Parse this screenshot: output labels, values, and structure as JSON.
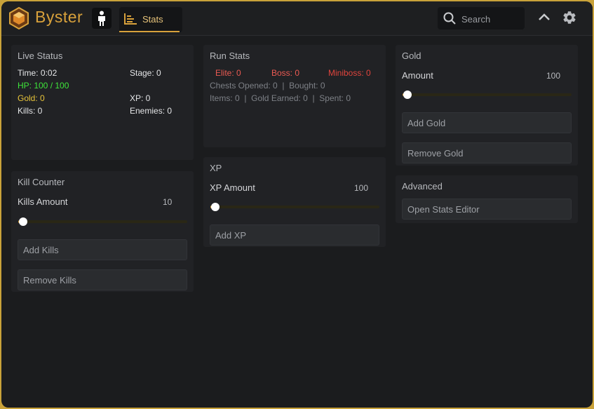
{
  "app": {
    "title": "Byster"
  },
  "tabs": [
    {
      "label": "Stats",
      "icon": "bar-chart-icon"
    }
  ],
  "search": {
    "placeholder": "Search"
  },
  "live_status": {
    "title": "Live Status",
    "time": "Time: 0:02",
    "stage": "Stage: 0",
    "hp": "HP: 100 / 100",
    "gold": "Gold: 0",
    "xp": "XP: 0",
    "kills": "Kills: 0",
    "enemies": "Enemies: 0"
  },
  "kill_counter": {
    "title": "Kill Counter",
    "amount_label": "Kills Amount",
    "amount_value": "10",
    "slider_fraction": 0.03,
    "add_label": "Add Kills",
    "remove_label": "Remove Kills"
  },
  "run_stats": {
    "title": "Run Stats",
    "elite": "Elite: 0",
    "boss": "Boss: 0",
    "miniboss": "Miniboss: 0",
    "line2": "Chests Opened: 0  |  Bought: 0",
    "line3": "Items: 0  |  Gold Earned: 0  |  Spent: 0"
  },
  "xp": {
    "title": "XP",
    "amount_label": "XP Amount",
    "amount_value": "100",
    "slider_fraction": 0.03,
    "add_label": "Add XP"
  },
  "gold": {
    "title": "Gold",
    "amount_label": "Amount",
    "amount_value": "100",
    "slider_fraction": 0.03,
    "add_label": "Add Gold",
    "remove_label": "Remove Gold"
  },
  "advanced": {
    "title": "Advanced",
    "open_editor_label": "Open Stats Editor"
  },
  "colors": {
    "accent": "#d8a13b",
    "hp": "#3ee53a",
    "gold": "#e8c43a",
    "danger": "#e0443c"
  }
}
